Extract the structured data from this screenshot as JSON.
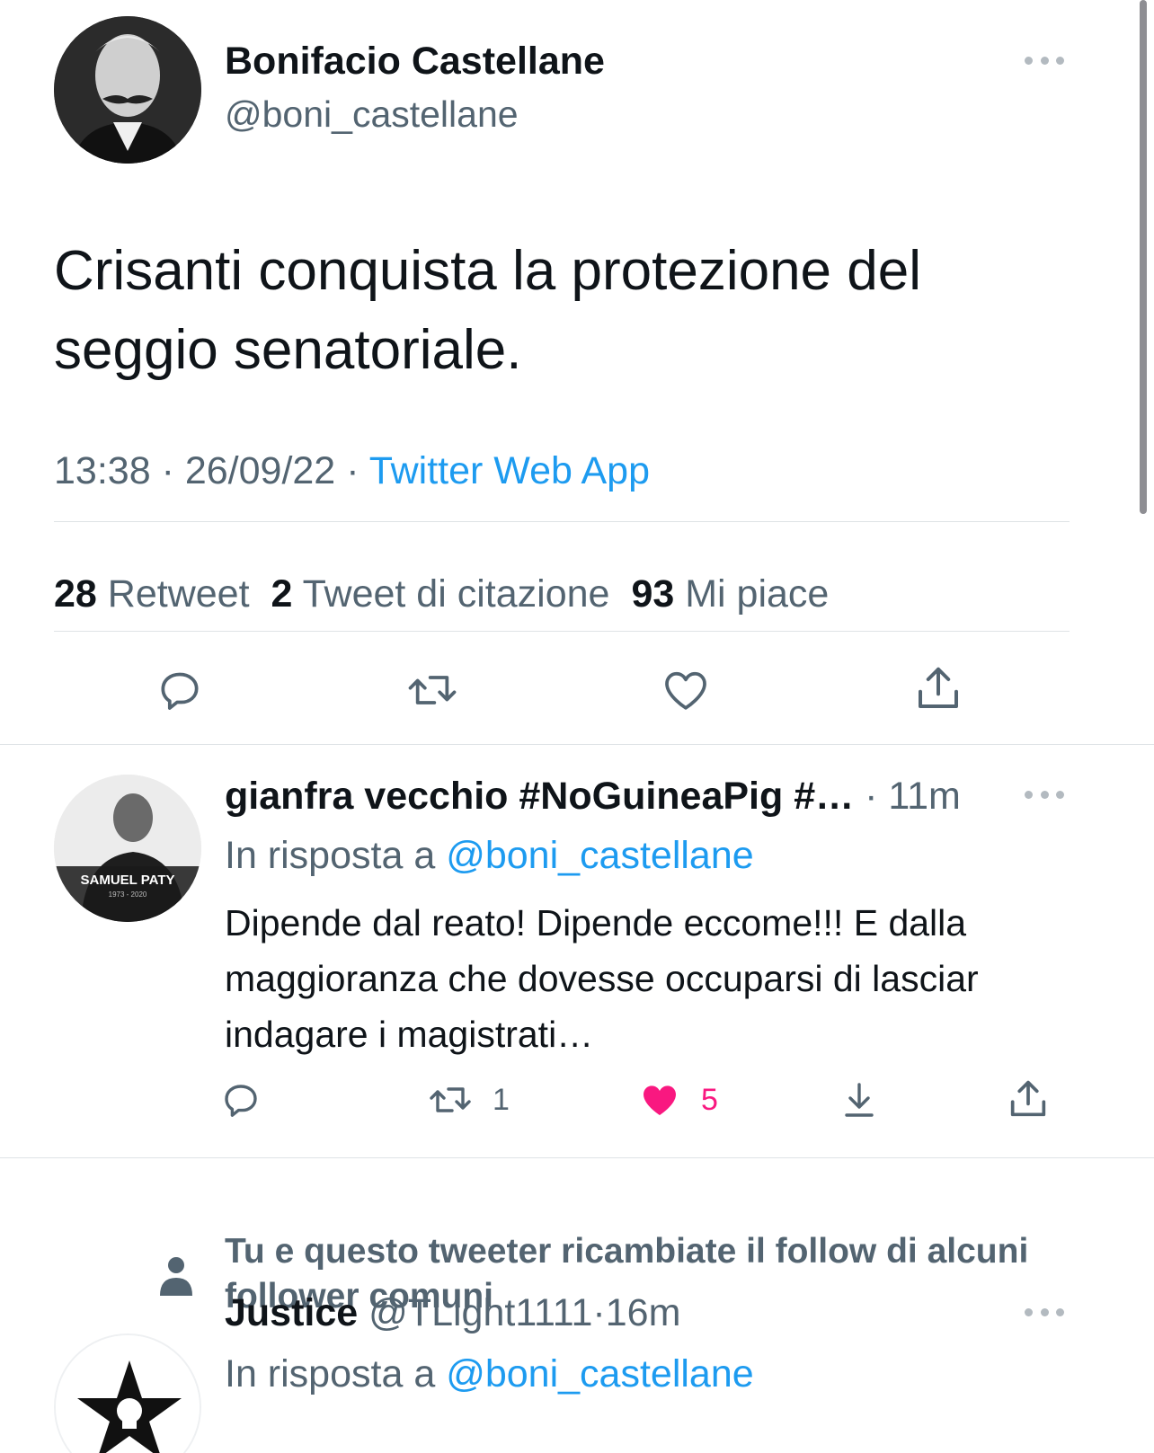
{
  "main_tweet": {
    "author_name": "Bonifacio Castellane",
    "author_handle": "@boni_castellane",
    "text": "Crisanti conquista la protezione del seggio senatoriale.",
    "time": "13:38",
    "date": "26/09/22",
    "separator": "·",
    "source": "Twitter Web App",
    "stats": {
      "retweets_count": "28",
      "retweets_label": "Retweet",
      "quotes_count": "2",
      "quotes_label": "Tweet di citazione",
      "likes_count": "93",
      "likes_label": "Mi piace"
    },
    "actions": [
      "reply-icon",
      "retweet-icon",
      "heart-icon",
      "share-icon"
    ]
  },
  "replies": [
    {
      "author_name": "gianfra vecchio #NoGuineaPig #…",
      "separator": "·",
      "time": "11m",
      "avatar_caption": "SAMUEL PATY",
      "avatar_years": "1973 - 2020",
      "reply_prefix": "In risposta a",
      "reply_mention": "@boni_castellane",
      "text": "Dipende dal reato! Dipende eccome!!! E dalla maggioranza che dovesse occuparsi di lasciar indagare i magistrati…",
      "retweet_count": "1",
      "like_count": "5",
      "liked": true,
      "colors": {
        "like": "#f91880"
      }
    },
    {
      "social_context": "Tu e questo tweeter ricambiate il follow di alcuni follower comuni",
      "author_name": "Justice",
      "author_handle": "@TLight1111",
      "separator": "·",
      "time": "16m",
      "reply_prefix": "In risposta a",
      "reply_mention": "@boni_castellane"
    }
  ],
  "colors": {
    "link": "#1d9bf0",
    "secondary_text": "#536471",
    "primary_text": "#0f1419",
    "divider": "#dfe3e6",
    "like": "#f91880"
  }
}
